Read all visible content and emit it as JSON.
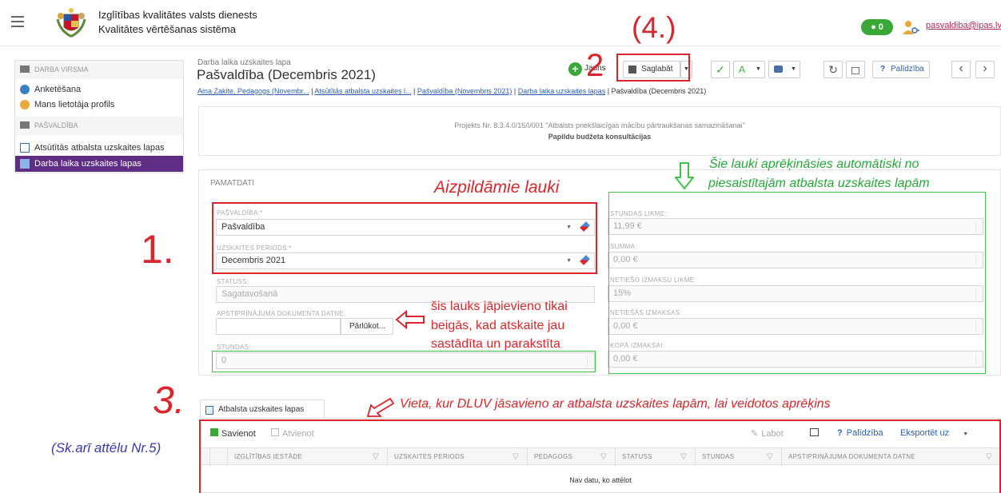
{
  "header": {
    "org_line1": "Izglītības kvalitātes valsts dienests",
    "org_line2": "Kvalitātes vērtēšanas sistēma",
    "notifications": "0",
    "user": "pasvaldiba@ipas.lv"
  },
  "sidebar": {
    "sections": [
      {
        "title": "DARBA VIRSMA",
        "items": [
          "Anketēšana",
          "Mans lietotāja profils"
        ]
      },
      {
        "title": "PAŠVALDĪBA",
        "items": [
          "Atsūtītās atbalsta uzskaites lapas",
          "Darba laika uzskaites lapas"
        ]
      }
    ],
    "active": "Darba laika uzskaites lapas"
  },
  "page": {
    "subtitle": "Darba laika uzskaites lapa",
    "title": "Pašvaldība (Decembris 2021)",
    "breadcrumb": [
      "Aina Zakite, Pedagogs (Novembr...",
      "Atsūtītās atbalsta uzskaites l...",
      "Pašvaldība (Novembris 2021)",
      "Darba laika uzskaites lapas",
      "Pašvaldība (Decembris 2021)"
    ]
  },
  "toolbar": {
    "new_label": "Jauns",
    "save_label": "Saglabāt",
    "help_label": "Palīdzība"
  },
  "project": {
    "line1": "Projekts Nr. 8.3.4.0/16/I/001 \"Atbalsts priekšlaicīgas mācību pārtraukšanas samazināšanai\"",
    "line2": "Papildu budžeta konsultācijas"
  },
  "form": {
    "section_title": "PAMATDATI",
    "pasvaldiba_label": "PAŠVALDĪBA:*",
    "pasvaldiba_value": "Pašvaldība",
    "periods_label": "UZSKAITES PERIODS:*",
    "periods_value": "Decembris 2021",
    "status_label": "STATUSS:",
    "status_value": "Sagatavošanā",
    "doc_label": "APSTIPRINĀJUMA DOKUMENTA DATNE:",
    "browse_label": "Pārlūkot...",
    "hours_label": "STUNDAS:",
    "hours_value": "0",
    "rate_label": "STUNDAS LIKME:",
    "rate_value": "11,99 €",
    "sum_label": "SUMMA:",
    "sum_value": "0,00 €",
    "indirect_rate_label": "NETIEŠO IZMAKSU LIKME:",
    "indirect_rate_value": "15%",
    "indirect_label": "NETIEŠĀS IZMAKSAS:",
    "indirect_value": "0,00 €",
    "total_label": "KOPĀ IZMAKSAI:",
    "total_value": "0,00 €"
  },
  "annotations": {
    "step4": "(4.)",
    "step2": "2",
    "step1": "1.",
    "step3": "3.",
    "fields_title": "Aizpildāmie lauki",
    "auto_line1": "Šie lauki aprēķināsies automātiski no",
    "auto_line2": "piesaistītajām atbalsta uzskaites lapām",
    "doc_note_line1": "šis lauks jāpievieno tikai",
    "doc_note_line2": "beigās, kad atskaite jau",
    "doc_note_line3": "sastādīta un parakstīta",
    "link_note": "Vieta, kur DLUV jāsavieno ar atbalsta uzskaites lapām, lai veidotos aprēķins",
    "see_also": "(Sk.arī attēlu Nr.5)"
  },
  "grid": {
    "tab_label": "Atbalsta uzskaites lapas",
    "connect_label": "Savienot",
    "disconnect_label": "Atvienot",
    "edit_label": "Labot",
    "help_label": "Palīdzība",
    "export_label": "Eksportēt uz",
    "columns": [
      "IZGLĪTĪBAS IESTĀDE",
      "UZSKAITES PERIODS",
      "PEDAGOGS",
      "STATUSS",
      "STUNDAS",
      "APSTIPRINĀJUMA DOKUMENTA DATNE"
    ],
    "empty": "Nav datu, ko attēlot"
  },
  "colors": {
    "accent": "#5f2d83",
    "annotation_red": "#d9262c",
    "annotation_green": "#3fc24a",
    "notification": "#3aa836"
  }
}
